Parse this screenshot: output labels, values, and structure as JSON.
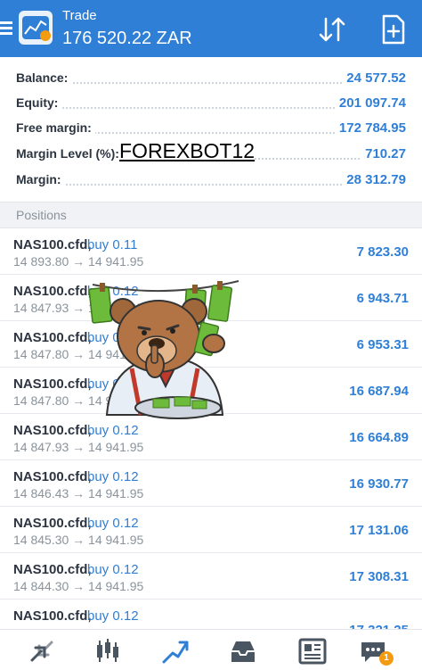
{
  "header": {
    "title": "Trade",
    "balance": "176 520.22 ZAR"
  },
  "summary": [
    {
      "label": "Balance:",
      "value": "24 577.52"
    },
    {
      "label": "Equity:",
      "value": "201 097.74"
    },
    {
      "label": "Free margin:",
      "value": "172 784.95"
    },
    {
      "label": "Margin Level (%):",
      "value": "710.27"
    },
    {
      "label": "Margin:",
      "value": "28 312.79"
    }
  ],
  "watermark": "FOREXBOT12",
  "positions_title": "Positions",
  "positions": [
    {
      "symbol": "NAS100.cfd,",
      "side": "buy 0.11",
      "prices": "14 893.80 → 14 941.95",
      "profit": "7 823.30"
    },
    {
      "symbol": "NAS100.cfd,",
      "side": "buy 0.12",
      "prices": "14 847.93 → 14 941.95",
      "profit": "6 943.71"
    },
    {
      "symbol": "NAS100.cfd,",
      "side": "buy 0.12",
      "prices": "14 847.80 → 14 941.95",
      "profit": "6 953.31"
    },
    {
      "symbol": "NAS100.cfd,",
      "side": "buy 0.29",
      "prices": "14 847.80 → 14 941.95",
      "profit": "16 687.94"
    },
    {
      "symbol": "NAS100.cfd,",
      "side": "buy 0.12",
      "prices": "14 847.93 → 14 941.95",
      "profit": "16 664.89"
    },
    {
      "symbol": "NAS100.cfd,",
      "side": "buy 0.12",
      "prices": "14 846.43 → 14 941.95",
      "profit": "16 930.77"
    },
    {
      "symbol": "NAS100.cfd,",
      "side": "buy 0.12",
      "prices": "14 845.30 → 14 941.95",
      "profit": "17 131.06"
    },
    {
      "symbol": "NAS100.cfd,",
      "side": "buy 0.12",
      "prices": "14 844.30 → 14 941.95",
      "profit": "17 308.31"
    },
    {
      "symbol": "NAS100.cfd,",
      "side": "buy 0.12",
      "prices": "",
      "profit": "17 321.25"
    }
  ],
  "nav": {
    "items": [
      "quotes-icon",
      "chart-icon",
      "trade-icon",
      "history-icon",
      "news-icon",
      "messages-icon"
    ],
    "active": "trade-icon",
    "badge": "1"
  },
  "colors": {
    "accent": "#2f7fd6",
    "badge": "#f39c12"
  }
}
